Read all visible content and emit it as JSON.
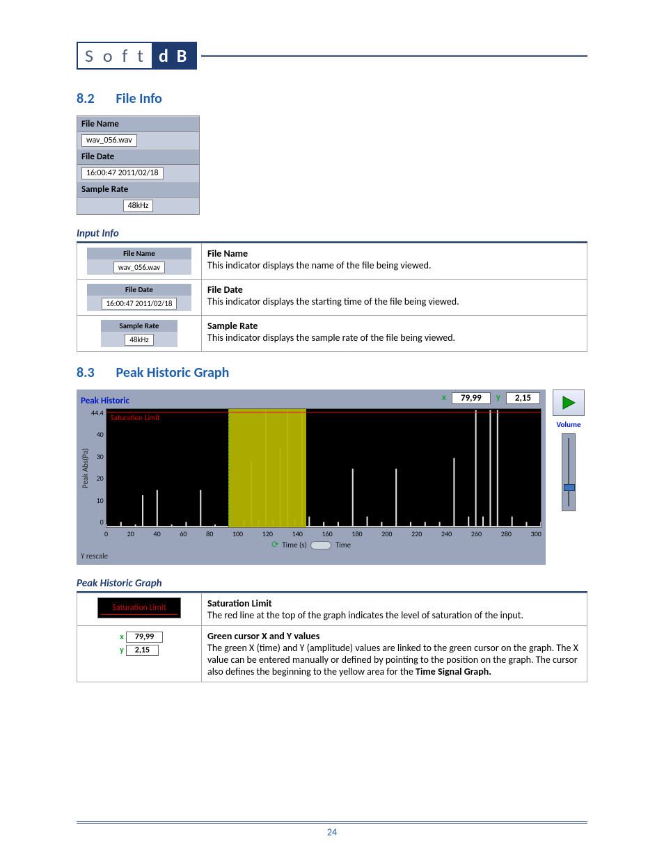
{
  "logo": {
    "left": "S o f t",
    "right": "d B"
  },
  "section_82": {
    "num": "8.2",
    "title": "File Info"
  },
  "fileinfo": {
    "file_name_label": "File Name",
    "file_name": "wav_056.wav",
    "file_date_label": "File Date",
    "file_date": "16:00:47 2011/02/18",
    "sample_rate_label": "Sample Rate",
    "sample_rate": "48kHz"
  },
  "input_info_heading": "Input Info",
  "input_info_rows": [
    {
      "label": "File Name",
      "value": "wav_056.wav",
      "head": "File Name",
      "desc": "This indicator displays the name of the file being viewed."
    },
    {
      "label": "File Date",
      "value": "16:00:47 2011/02/18",
      "head": "File Date",
      "desc": "This indicator displays the starting time of the file being viewed."
    },
    {
      "label": "Sample Rate",
      "value": "48kHz",
      "head": "Sample Rate",
      "desc": "This indicator displays the sample rate of the file being viewed."
    }
  ],
  "section_83": {
    "num": "8.3",
    "title": "Peak Historic Graph"
  },
  "chart": {
    "title": "Peak Historic",
    "ylabel": "Peak Abs(Pa)",
    "xlabel": "Time (s)",
    "xslider_label": "Time",
    "yrescale": "Y rescale",
    "saturation_label": "Saturation Limit",
    "cursor_x_label": "x",
    "cursor_x": "79,99",
    "cursor_y_label": "y",
    "cursor_y": "2,15",
    "volume_label": "Volume"
  },
  "chart_data": {
    "type": "line",
    "xlabel": "Time (s)",
    "ylabel": "Peak Abs(Pa)",
    "xlim": [
      0,
      300
    ],
    "ylim": [
      0,
      44.4
    ],
    "xticks": [
      0,
      20,
      40,
      60,
      80,
      100,
      120,
      140,
      160,
      180,
      200,
      220,
      240,
      260,
      280,
      300
    ],
    "yticks": [
      0,
      10,
      20,
      30,
      40,
      44.4
    ],
    "saturation_limit": 42,
    "cursor": {
      "x": 79.99,
      "y": 2.15
    },
    "highlight_range": [
      80,
      135
    ],
    "series": [
      {
        "name": "Peak Abs(Pa)",
        "x": [
          0,
          10,
          20,
          25,
          35,
          45,
          55,
          65,
          75,
          85,
          95,
          100,
          105,
          110,
          115,
          120,
          125,
          130,
          135,
          140,
          150,
          160,
          170,
          180,
          190,
          200,
          210,
          220,
          230,
          240,
          250,
          255,
          260,
          265,
          270,
          280,
          290,
          300
        ],
        "values": [
          1,
          2,
          1,
          12,
          14,
          1,
          2,
          14,
          1,
          2,
          3,
          25,
          3,
          44,
          3,
          30,
          44,
          3,
          44,
          4,
          2,
          2,
          22,
          4,
          2,
          22,
          2,
          2,
          2,
          26,
          4,
          44,
          4,
          44,
          44,
          4,
          2,
          2
        ]
      }
    ]
  },
  "phg_heading": "Peak Historic Graph",
  "phg_rows": [
    {
      "head": "Saturation Limit",
      "desc": "The red line at the top of the graph indicates the level of saturation of the input."
    },
    {
      "head": "Green cursor X and Y values",
      "desc": "The green X (time) and Y (amplitude) values are linked to the green cursor on the graph. The X value can be entered manually or defined by pointing to the position on the graph. The cursor also defines the beginning to the yellow area for the ",
      "bold_tail": "Time Signal Graph."
    }
  ],
  "page_number": "24"
}
